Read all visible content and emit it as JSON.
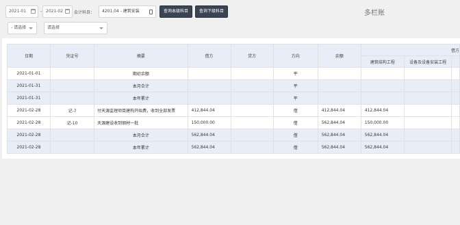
{
  "filters": {
    "date_from": "2021-01",
    "date_separator": "-",
    "date_to": "2021-02",
    "subject_label": "会计科目：",
    "subject_value": "4201.04 - 建筑安装",
    "query_current_button": "查询本级科目",
    "query_sub_button": "查询下级科目",
    "select_one_placeholder": "- 请选择",
    "select_two_placeholder": "请选择"
  },
  "page_title": "多栏账",
  "table": {
    "headers": [
      "日期",
      "凭证号",
      "摘要",
      "借方",
      "贷方",
      "方向",
      "余额"
    ],
    "group_header": "借方",
    "sub_headers": [
      "建筑结构工程",
      "设备及设备安装工程"
    ],
    "rows": [
      {
        "date": "2021-01-01",
        "voucher": "",
        "summary": "期初余额",
        "debit": "",
        "credit": "",
        "direction": "平",
        "balance": "",
        "sub1": "",
        "sub2": "",
        "highlight": false
      },
      {
        "date": "2021-01-31",
        "voucher": "",
        "summary": "本月合计",
        "debit": "",
        "credit": "",
        "direction": "平",
        "balance": "",
        "sub1": "",
        "sub2": "",
        "highlight": true
      },
      {
        "date": "2021-01-31",
        "voucher": "",
        "summary": "本年累计",
        "debit": "",
        "credit": "",
        "direction": "平",
        "balance": "",
        "sub1": "",
        "sub2": "",
        "highlight": true
      },
      {
        "date": "2021-02-28",
        "voucher": "记-7",
        "summary": "付天源监理项目建构开始费，收到全部发票",
        "debit": "412,844.04",
        "credit": "",
        "direction": "借",
        "balance": "412,844.04",
        "sub1": "412,844.04",
        "sub2": "",
        "highlight": false
      },
      {
        "date": "2021-02-28",
        "voucher": "记-10",
        "summary": "天源建设收到钢材一批",
        "debit": "150,000.00",
        "credit": "",
        "direction": "借",
        "balance": "562,844.04",
        "sub1": "150,000.00",
        "sub2": "",
        "highlight": false
      },
      {
        "date": "2021-02-28",
        "voucher": "",
        "summary": "本月合计",
        "debit": "562,844.04",
        "credit": "",
        "direction": "借",
        "balance": "562,844.04",
        "sub1": "562,844.04",
        "sub2": "",
        "highlight": true
      },
      {
        "date": "2021-02-28",
        "voucher": "",
        "summary": "本年累计",
        "debit": "562,844.04",
        "credit": "",
        "direction": "借",
        "balance": "562,844.04",
        "sub1": "562,844.04",
        "sub2": "",
        "highlight": true
      }
    ]
  }
}
